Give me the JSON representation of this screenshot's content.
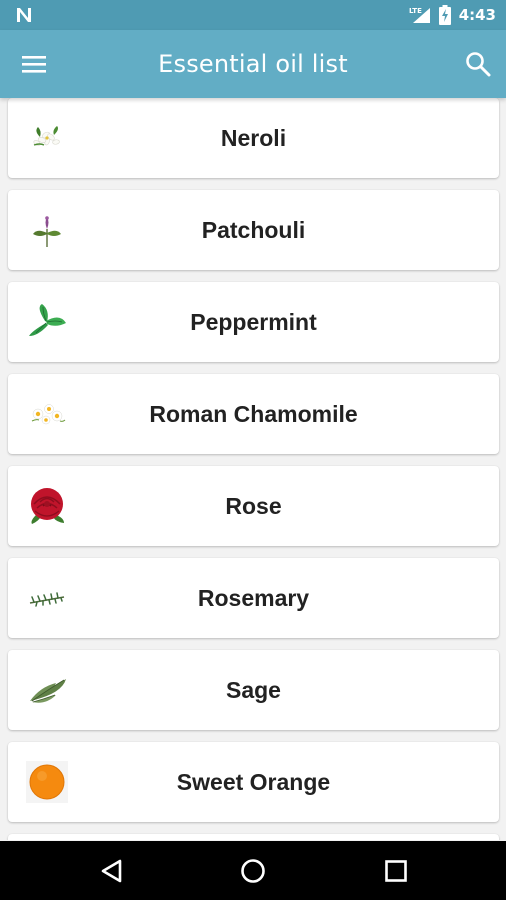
{
  "status_bar": {
    "time": "4:43",
    "network_label": "LTE",
    "icons": [
      "notification-n-icon",
      "lte-signal-icon",
      "battery-icon"
    ]
  },
  "app_bar": {
    "title": "Essential oil list",
    "menu_icon": "hamburger-menu-icon",
    "search_icon": "search-icon"
  },
  "oils": [
    {
      "name": "Neroli",
      "icon": "neroli-flower-icon"
    },
    {
      "name": "Patchouli",
      "icon": "patchouli-leaf-icon"
    },
    {
      "name": "Peppermint",
      "icon": "peppermint-leaf-icon"
    },
    {
      "name": "Roman Chamomile",
      "icon": "chamomile-flower-icon"
    },
    {
      "name": "Rose",
      "icon": "rose-flower-icon"
    },
    {
      "name": "Rosemary",
      "icon": "rosemary-sprig-icon"
    },
    {
      "name": "Sage",
      "icon": "sage-leaf-icon"
    },
    {
      "name": "Sweet Orange",
      "icon": "orange-fruit-icon"
    }
  ],
  "nav_bar": {
    "icons": [
      "back-triangle-icon",
      "home-circle-icon",
      "recents-square-icon"
    ]
  },
  "colors": {
    "status_bar": "#4f9bb3",
    "app_bar": "#62adc5",
    "background": "#f2f2f2"
  }
}
